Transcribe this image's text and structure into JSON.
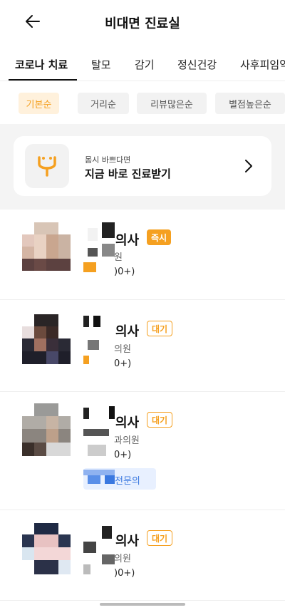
{
  "header": {
    "title": "비대면 진료실",
    "back_icon": "arrow-left-icon"
  },
  "tabs": [
    {
      "label": "코로나 치료",
      "active": true
    },
    {
      "label": "탈모",
      "active": false
    },
    {
      "label": "감기",
      "active": false
    },
    {
      "label": "정신건강",
      "active": false
    },
    {
      "label": "사후피임약",
      "active": false
    }
  ],
  "sort_chips": [
    {
      "label": "기본순",
      "active": true
    },
    {
      "label": "거리순",
      "active": false
    },
    {
      "label": "리뷰많은순",
      "active": false
    },
    {
      "label": "별점높은순",
      "active": false
    }
  ],
  "banner": {
    "subtitle": "몸시 바쁘다면",
    "title": "지금 바로 진료받기",
    "icon": "stethoscope-smile-icon",
    "chevron_icon": "chevron-right-icon"
  },
  "doctors": [
    {
      "name_suffix": "의사",
      "badge": "즉시",
      "badge_type": "now",
      "hospital": "원",
      "reviews": ")0+)"
    },
    {
      "name_suffix": "의사",
      "badge": "대기",
      "badge_type": "wait",
      "hospital": "의원",
      "reviews": "0+)"
    },
    {
      "name_suffix": "의사",
      "badge": "대기",
      "badge_type": "wait",
      "hospital": "과의원",
      "reviews": "0+)",
      "specialty": "전문의"
    },
    {
      "name_suffix": "의사",
      "badge": "대기",
      "badge_type": "wait",
      "hospital": "의원",
      "reviews": ")0+)"
    }
  ],
  "colors": {
    "accent": "#f5a020",
    "accent_bg": "#fff1dc",
    "blue": "#3a78e0"
  }
}
